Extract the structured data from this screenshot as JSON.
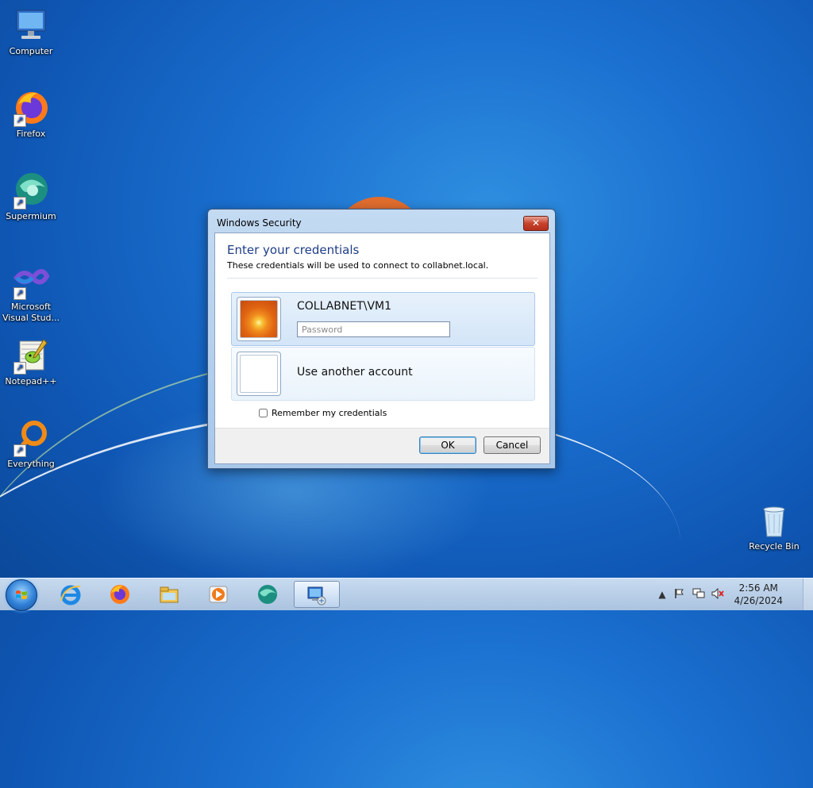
{
  "desktop": {
    "icons": [
      {
        "label": "Computer"
      },
      {
        "label": "Firefox"
      },
      {
        "label": "Supermium"
      },
      {
        "label": "Microsoft Visual Stud..."
      },
      {
        "label": "Notepad++"
      },
      {
        "label": "Everything"
      },
      {
        "label": "Recycle Bin"
      }
    ]
  },
  "dialog": {
    "title": "Windows Security",
    "heading": "Enter your credentials",
    "subtext": "These credentials will be used to connect to collabnet.local.",
    "account": {
      "name": "COLLABNET\\VM1",
      "password_placeholder": "Password",
      "password_value": ""
    },
    "other_account_label": "Use another account",
    "remember_label": "Remember my credentials",
    "remember_checked": false,
    "ok_label": "OK",
    "cancel_label": "Cancel",
    "close_glyph": "✕"
  },
  "taskbar": {
    "pinned": [
      "internet-explorer-icon",
      "firefox-icon",
      "file-explorer-icon",
      "media-player-icon",
      "supermium-icon",
      "remote-desktop-icon"
    ],
    "active_app": "remote-desktop-icon",
    "tray": {
      "time": "2:56 AM",
      "date": "4/26/2024"
    }
  }
}
